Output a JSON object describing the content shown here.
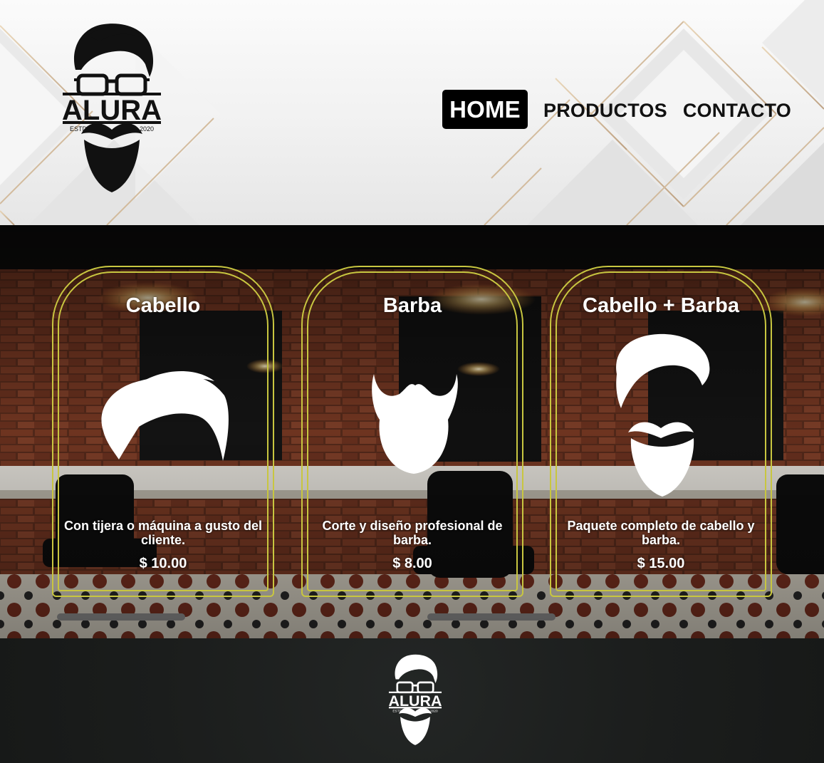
{
  "brand": {
    "name": "ALURA",
    "estd_left": "ESTD",
    "estd_right": "2020"
  },
  "nav": {
    "home": "HOME",
    "productos": "PRODUCTOS",
    "contacto": "CONTACTO"
  },
  "services": [
    {
      "title": "Cabello",
      "description": "Con tijera o máquina a gusto del cliente.",
      "price": "$ 10.00",
      "icon": "hair-icon"
    },
    {
      "title": "Barba",
      "description": "Corte y diseño profesional de barba.",
      "price": "$ 8.00",
      "icon": "beard-icon"
    },
    {
      "title": "Cabello + Barba",
      "description": "Paquete completo de cabello y barba.",
      "price": "$ 15.00",
      "icon": "hair-beard-icon"
    }
  ],
  "colors": {
    "card_border": "#c8c640",
    "nav_active_bg": "#000000",
    "footer_bg": "#1b1d1c"
  }
}
